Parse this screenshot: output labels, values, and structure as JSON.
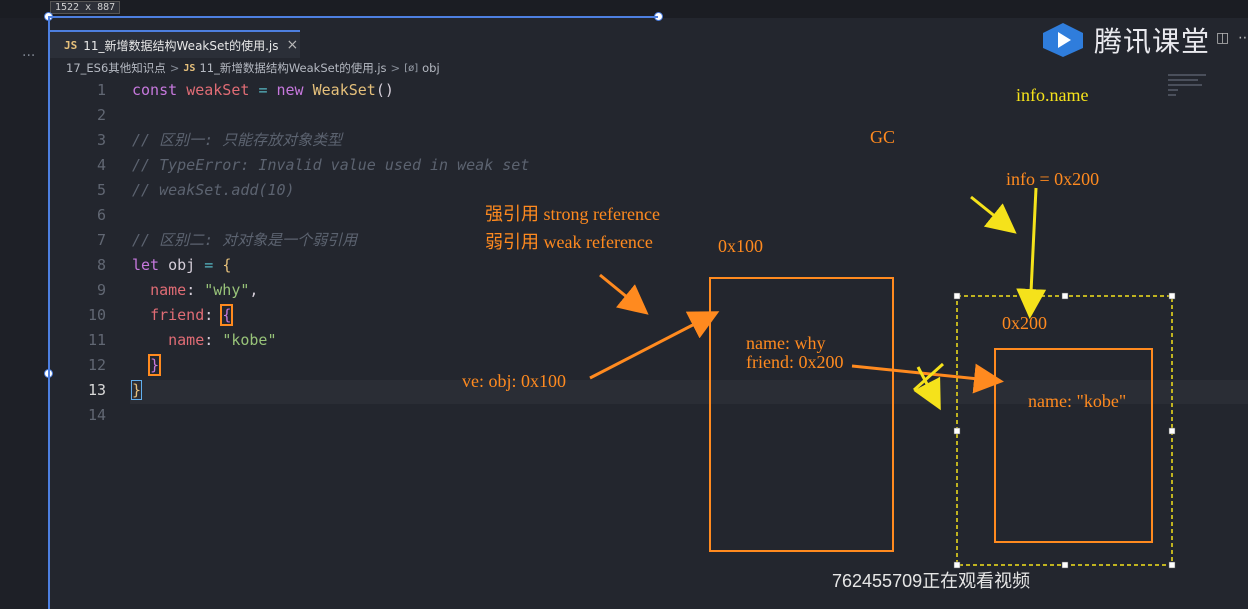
{
  "window": {
    "size_badge": "1522 x 887"
  },
  "activity_bar": {
    "more_glyph": "···"
  },
  "tab": {
    "lang": "JS",
    "title": "11_新增数据结构WeakSet的使用.js",
    "close": "×"
  },
  "breadcrumb": {
    "folder": "17_ES6其他知识点",
    "lang": "JS",
    "file": "11_新增数据结构WeakSet的使用.js",
    "symbol_icon": "[ø]",
    "symbol": "obj",
    "separator": ">"
  },
  "brand": {
    "text": "腾讯课堂",
    "icon": "play-logo-icon"
  },
  "code": {
    "line_numbers": [
      "1",
      "2",
      "3",
      "4",
      "5",
      "6",
      "7",
      "8",
      "9",
      "10",
      "11",
      "12",
      "13",
      "14"
    ],
    "current_line": 13,
    "lines": {
      "l1": {
        "kw": "const",
        "var": "weakSet",
        "eq": "=",
        "new": "new",
        "cls": "WeakSet",
        "paren": "()"
      },
      "l3": "// 区别一: 只能存放对象类型",
      "l4": "// TypeError: Invalid value used in weak set",
      "l5": "// weakSet.add(10)",
      "l7": "// 区别二: 对对象是一个弱引用",
      "l8": {
        "kw": "let",
        "var": "obj",
        "eq": "=",
        "open": "{"
      },
      "l9": {
        "key": "name",
        "colon": ":",
        "val": "\"why\"",
        "comma": ","
      },
      "l10": {
        "key": "friend",
        "colon": ":",
        "open": "{"
      },
      "l11": {
        "key": "name",
        "colon": ":",
        "val": "\"kobe\""
      },
      "l12": {
        "close": "}"
      },
      "l13": {
        "close": "}"
      }
    }
  },
  "annotations": {
    "info_name": "info.name",
    "gc": "GC",
    "info_assign": "info = 0x200",
    "strong_ref": "强引用 strong reference",
    "weak_ref": "弱引用 weak reference",
    "addr_100": "0x100",
    "addr_200": "0x200",
    "obj1_name": "name: why",
    "obj1_friend": "friend: 0x200",
    "obj2_name": "name: \"kobe\"",
    "ve_obj": "ve: obj: 0x100"
  },
  "colors": {
    "orange": "#ff8a1f",
    "yellow": "#f5e21b",
    "accent": "#4d7fe0"
  },
  "watermark": "762455709正在观看视频"
}
